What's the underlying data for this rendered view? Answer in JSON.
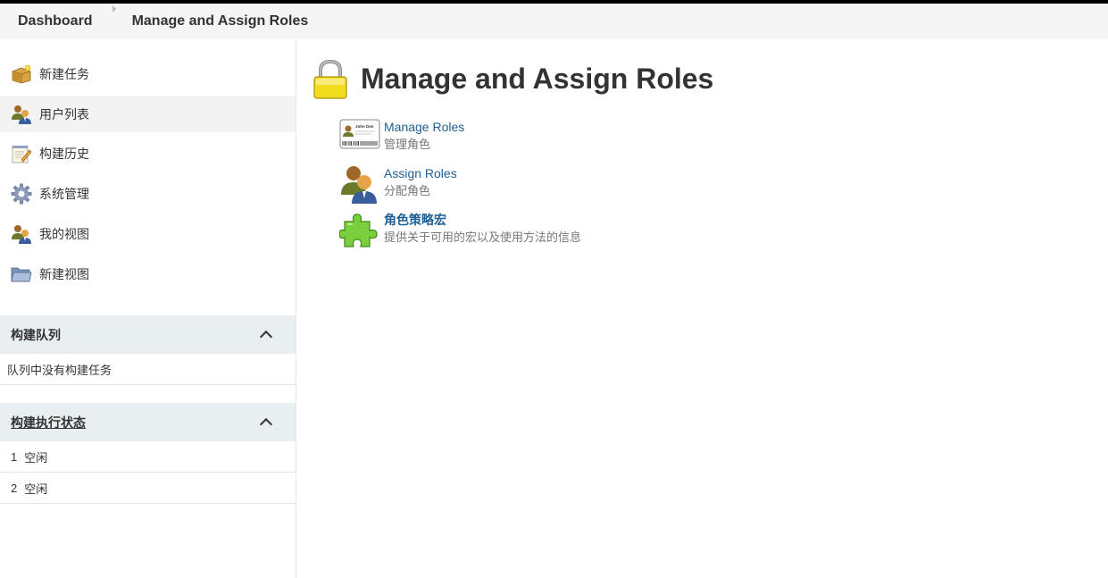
{
  "breadcrumbs": [
    {
      "label": "Dashboard"
    },
    {
      "label": "Manage and Assign Roles"
    }
  ],
  "sidebar": {
    "tasks": [
      {
        "label": "新建任务",
        "icon": "new-package-icon"
      },
      {
        "label": "用户列表",
        "icon": "users-icon"
      },
      {
        "label": "构建历史",
        "icon": "notepad-icon"
      },
      {
        "label": "系统管理",
        "icon": "gear-icon"
      },
      {
        "label": "我的视图",
        "icon": "users-icon"
      },
      {
        "label": "新建视图",
        "icon": "folder-icon"
      }
    ],
    "queue": {
      "title": "构建队列",
      "empty_text": "队列中没有构建任务"
    },
    "executors": {
      "title": "构建执行状态",
      "rows": [
        {
          "num": "1",
          "status": "空闲"
        },
        {
          "num": "2",
          "status": "空闲"
        }
      ]
    }
  },
  "main": {
    "title": "Manage and Assign Roles",
    "title_icon": "lock-icon",
    "entries": [
      {
        "link": "Manage Roles",
        "desc": "管理角色",
        "icon": "id-card-icon",
        "card_name": "John Doe"
      },
      {
        "link": "Assign Roles",
        "desc": "分配角色",
        "icon": "users-icon"
      },
      {
        "link": "角色策略宏",
        "desc": "提供关于可用的宏以及使用方法的信息",
        "icon": "puzzle-icon"
      }
    ]
  },
  "colors": {
    "link": "#1f5f94",
    "pane_header_bg": "#e9eef0",
    "breadcrumb_bg": "#f5f5f5"
  }
}
